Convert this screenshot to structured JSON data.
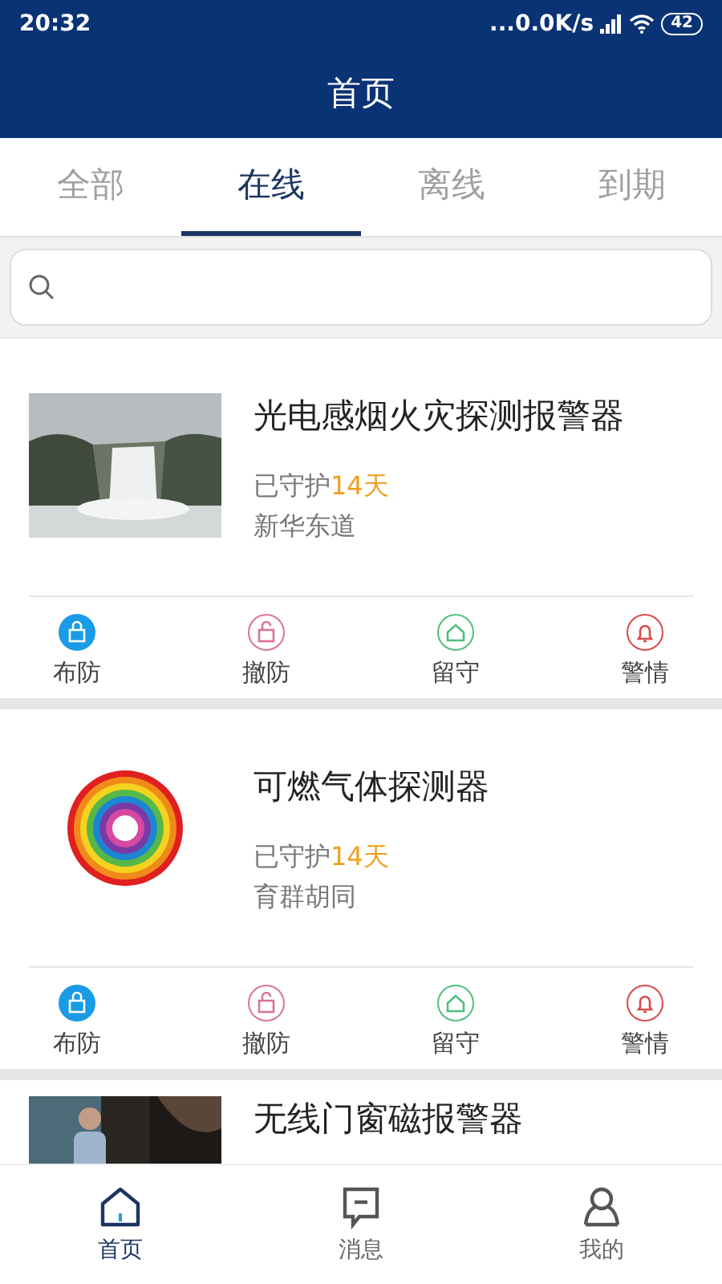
{
  "status_bar": {
    "time": "20:32",
    "network_speed": "...0.0K/s",
    "battery": "42"
  },
  "header": {
    "title": "首页"
  },
  "tabs": [
    {
      "label": "全部",
      "selected": false
    },
    {
      "label": "在线",
      "selected": true
    },
    {
      "label": "离线",
      "selected": false
    },
    {
      "label": "到期",
      "selected": false
    }
  ],
  "devices": [
    {
      "name": "光电感烟火灾探测报警器",
      "guard_prefix": "已守护",
      "guard_days": "14天",
      "location": "新华东道",
      "actions": [
        {
          "label": "布防",
          "kind": "lock",
          "color": "#1a9be6",
          "active": true
        },
        {
          "label": "撤防",
          "kind": "unlock",
          "color": "#d9739a",
          "active": false
        },
        {
          "label": "留守",
          "kind": "home",
          "color": "#4fbf80",
          "active": false
        },
        {
          "label": "警情",
          "kind": "bell",
          "color": "#d94b4b",
          "active": false
        }
      ]
    },
    {
      "name": "可燃气体探测器",
      "guard_prefix": "已守护",
      "guard_days": "14天",
      "location": "育群胡同",
      "actions": [
        {
          "label": "布防",
          "kind": "lock",
          "color": "#1a9be6",
          "active": true
        },
        {
          "label": "撤防",
          "kind": "unlock",
          "color": "#d9739a",
          "active": false
        },
        {
          "label": "留守",
          "kind": "home",
          "color": "#4fbf80",
          "active": false
        },
        {
          "label": "警情",
          "kind": "bell",
          "color": "#d94b4b",
          "active": false
        }
      ]
    },
    {
      "name": "无线门窗磁报警器"
    }
  ],
  "bottom_nav": [
    {
      "label": "首页",
      "kind": "home",
      "selected": true
    },
    {
      "label": "消息",
      "kind": "message",
      "selected": false
    },
    {
      "label": "我的",
      "kind": "user",
      "selected": false
    }
  ]
}
